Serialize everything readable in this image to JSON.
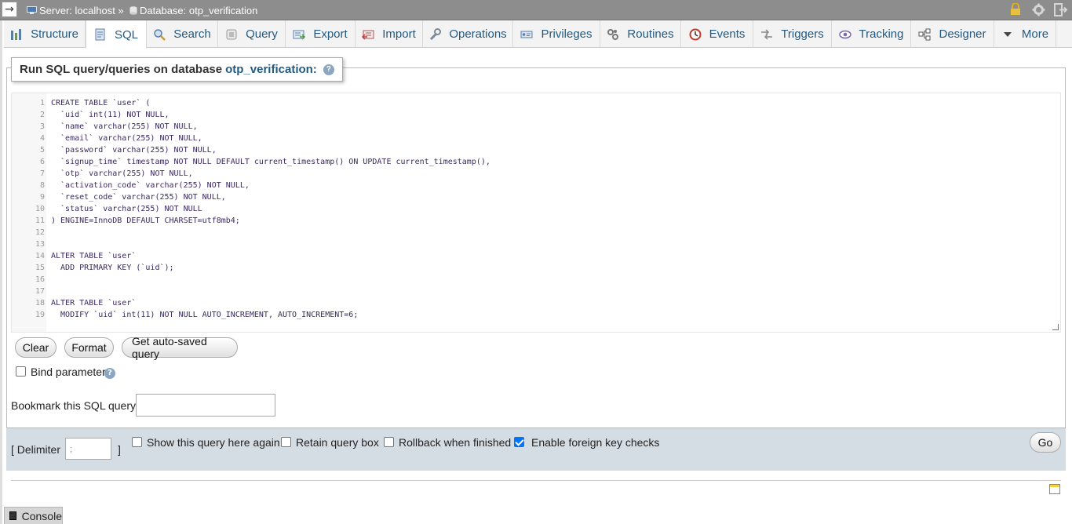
{
  "topbar": {
    "toggle_glyph": "→",
    "server_crumb": "Server: localhost »",
    "database_crumb": "Database: otp_verification",
    "right_icons": [
      "lock-icon",
      "gear-icon",
      "exit-icon"
    ]
  },
  "tabs": [
    {
      "label": "Structure",
      "icon": "structure-icon"
    },
    {
      "label": "SQL",
      "icon": "sql-icon",
      "active": true
    },
    {
      "label": "Search",
      "icon": "search-icon"
    },
    {
      "label": "Query",
      "icon": "query-icon"
    },
    {
      "label": "Export",
      "icon": "export-icon"
    },
    {
      "label": "Import",
      "icon": "import-icon"
    },
    {
      "label": "Operations",
      "icon": "wrench-icon"
    },
    {
      "label": "Privileges",
      "icon": "privileges-icon"
    },
    {
      "label": "Routines",
      "icon": "routines-icon"
    },
    {
      "label": "Events",
      "icon": "clock-icon"
    },
    {
      "label": "Triggers",
      "icon": "triggers-icon"
    },
    {
      "label": "Tracking",
      "icon": "eye-icon"
    },
    {
      "label": "Designer",
      "icon": "designer-icon"
    },
    {
      "label": "More",
      "icon": "triangle-down-icon"
    }
  ],
  "legend": {
    "prefix": "Run SQL query/queries on database",
    "database": "otp_verification:"
  },
  "editor": {
    "lines": [
      "CREATE TABLE `user` (",
      "  `uid` int(11) NOT NULL,",
      "  `name` varchar(255) NOT NULL,",
      "  `email` varchar(255) NOT NULL,",
      "  `password` varchar(255) NOT NULL,",
      "  `signup_time` timestamp NOT NULL DEFAULT current_timestamp() ON UPDATE current_timestamp(),",
      "  `otp` varchar(255) NOT NULL,",
      "  `activation_code` varchar(255) NOT NULL,",
      "  `reset_code` varchar(255) NOT NULL,",
      "  `status` varchar(255) NOT NULL",
      ") ENGINE=InnoDB DEFAULT CHARSET=utf8mb4;",
      "",
      "",
      "ALTER TABLE `user`",
      "  ADD PRIMARY KEY (`uid`);",
      "",
      "",
      "ALTER TABLE `user`",
      "  MODIFY `uid` int(11) NOT NULL AUTO_INCREMENT, AUTO_INCREMENT=6;"
    ]
  },
  "buttons": {
    "clear": "Clear",
    "format": "Format",
    "autosaved": "Get auto-saved query",
    "go": "Go"
  },
  "options": {
    "bind_parameters": "Bind parameters",
    "bookmark_label": "Bookmark this SQL query:",
    "delimiter_open": "[ Delimiter",
    "delimiter_value": ";",
    "delimiter_close": "]",
    "show_query_again": "Show this query here again",
    "retain_query_box": "Retain query box",
    "rollback": "Rollback when finished",
    "foreign_key_checks": "Enable foreign key checks",
    "foreign_key_checks_checked": true
  },
  "console": {
    "label": "Console"
  }
}
